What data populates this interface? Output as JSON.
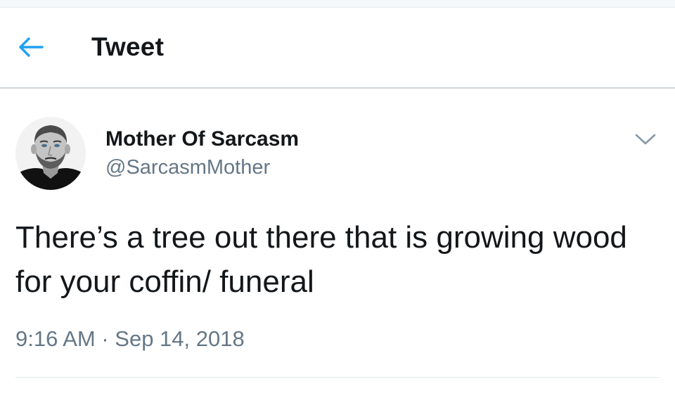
{
  "header": {
    "back_icon": "arrow-left-icon",
    "title": "Tweet"
  },
  "tweet": {
    "author": {
      "name": "Mother Of Sarcasm",
      "handle": "@SarcasmMother",
      "avatar": "profile-photo"
    },
    "menu_icon": "chevron-down-icon",
    "text": "There’s a tree out there that is growing wood for your coffin/ funeral",
    "timestamp": "9:16 AM · Sep 14, 2018"
  },
  "colors": {
    "accent": "#1da1f2",
    "text": "#14171a",
    "secondary_text": "#657786",
    "divider": "#e1e8ed"
  }
}
